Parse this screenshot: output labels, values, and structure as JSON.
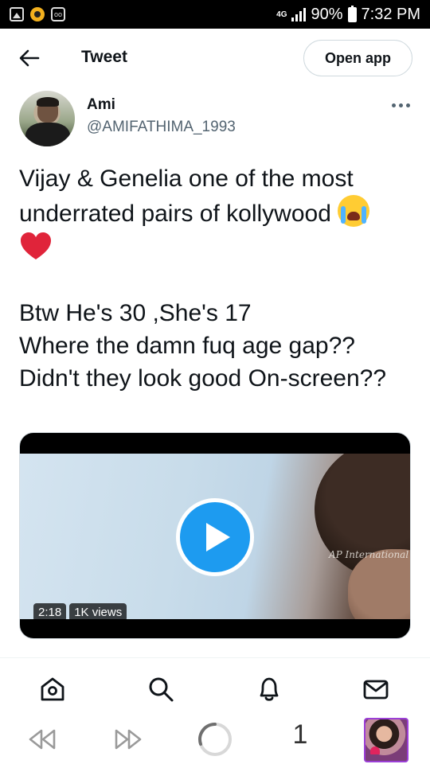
{
  "status_bar": {
    "network": "4G",
    "battery": "90%",
    "time": "7:32 PM",
    "icons": [
      "gallery-icon",
      "coin-icon",
      "owl-icon",
      "signal-icon",
      "battery-icon"
    ]
  },
  "header": {
    "title": "Tweet",
    "open_app_label": "Open app"
  },
  "tweet": {
    "author_name": "Ami",
    "author_handle": "@AMIFATHIMA_1993",
    "text_line1": "Vijay & Genelia one of the most underrated pairs of kollywood",
    "text_line2": "Btw He's 30 ,She's 17",
    "text_line3": "Where the damn fuq age gap??",
    "text_line4": "Didn't they look good On-screen??"
  },
  "video": {
    "duration": "2:18",
    "views": "1K views",
    "watermark": "AP International",
    "accent": "#1d9bf0"
  },
  "bottom_nav": {
    "items": [
      "home-icon",
      "search-icon",
      "notifications-icon",
      "messages-icon"
    ]
  },
  "browser_bar": {
    "tab_count": "1",
    "items": [
      "back-icon",
      "forward-icon",
      "reload-icon",
      "tabs-count",
      "profile-thumbnail"
    ]
  }
}
